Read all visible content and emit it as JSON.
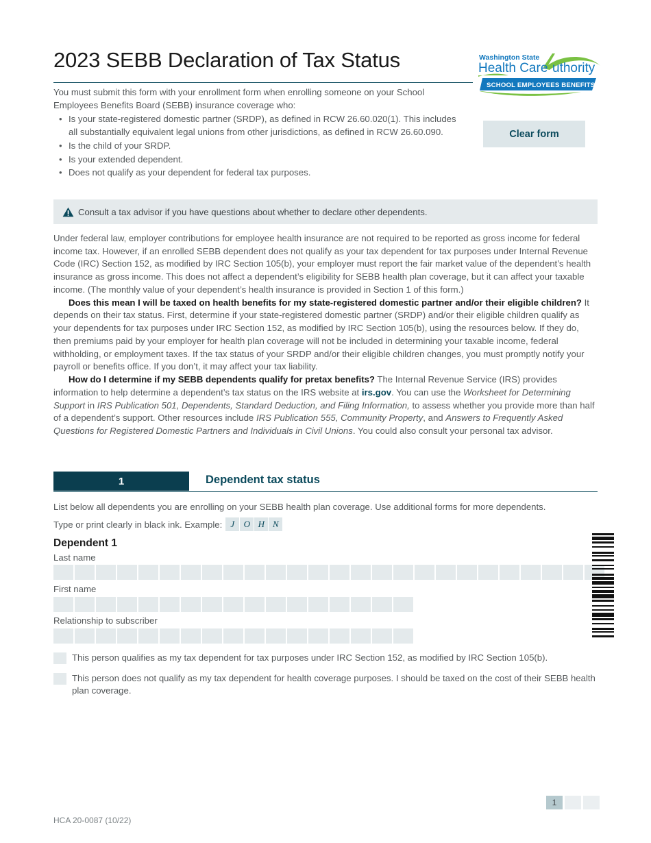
{
  "document": {
    "title": "2023 SEBB Declaration of Tax Status",
    "intro_lead": "You must submit this form with your enrollment form when enrolling someone on your School Employees Benefits Board (SEBB) insurance coverage who:",
    "intro_bullets": [
      "Is your state-registered domestic partner (SRDP), as defined in RCW 26.60.020(1). This includes all substantially equivalent legal unions from other jurisdictions, as defined in RCW 26.60.090.",
      "Is the child of your SRDP.",
      "Is your extended dependent.",
      "Does not qualify as your dependent for federal tax purposes."
    ]
  },
  "logo": {
    "line1": "Washington State",
    "line2": "Health Care Authority",
    "banner": "SCHOOL EMPLOYEES BENEFITS BOARD",
    "blue": "#1278be",
    "green": "#7ac143"
  },
  "toolbar": {
    "clear_form_label": "Clear form"
  },
  "alert": {
    "icon": "warning-triangle-icon",
    "text": "Consult a tax advisor if you have questions about whether to declare other dependents."
  },
  "body": {
    "paragraph1": "Under federal law, employer contributions for employee health insurance are not required to be reported as gross income for federal income tax. However, if an enrolled SEBB dependent does not qualify as your tax dependent for tax purposes under Internal Revenue Code (IRC) Section 152, as modified by IRC Section 105(b), your employer must report the fair market value of the dependent’s health insurance as gross income. This does not affect a dependent’s eligibility for SEBB health plan coverage, but it can affect your taxable income. (The monthly value of your dependent’s health insurance is provided in Section 1 of this form.)",
    "q1_bold": "Does this mean I will be taxed on health benefits for my state-registered domestic partner and/or their eligible children?",
    "q1_rest": " It depends on their tax status. First, determine if your state-registered domestic partner (SRDP) and/or their eligible children qualify as your dependents for tax purposes under IRC Section 152, as modified by IRC Section 105(b), using the resources below. If they do, then premiums paid by your employer for health plan coverage will not be included in determining your taxable income, federal withholding, or employment taxes. If the tax status of your SRDP and/or their eligible children changes, you must promptly notify your payroll or benefits office. If you don’t, it may affect your tax liability.",
    "q2_bold": "How do I determine if my SEBB dependents qualify for pretax benefits?",
    "q2_part1": " The Internal Revenue Service (IRS) provides information to help determine a dependent’s tax status on the IRS website at ",
    "q2_link": "irs.gov",
    "q2_part2": ". You can use the ",
    "q2_italic1": "Worksheet for Determining Support",
    "q2_part3": " in ",
    "q2_italic2": "IRS Publication 501, Dependents, Standard Deduction, and Filing Information,",
    "q2_part4": " to assess whether you provide more than half of a dependent’s support. Other resources include ",
    "q2_italic3": "IRS Publication 555, Community Property",
    "q2_part5": ", and ",
    "q2_italic4": "Answers to Frequently Asked Questions for Registered Domestic Partners and Individuals in Civil Unions",
    "q2_part6": ". You could also consult your personal tax advisor."
  },
  "section1": {
    "number": "1",
    "title": "Dependent tax status",
    "instructions": "List below all dependents you are enrolling on your SEBB health plan coverage. Use additional forms for more dependents.",
    "example_label": "Type or print clearly in black ink. Example:",
    "example_letters": [
      "J",
      "O",
      "H",
      "N"
    ],
    "dependent_heading": "Dependent 1",
    "fields": [
      {
        "label": "Last name",
        "cells": 26
      },
      {
        "label": "First name",
        "cells": 17
      },
      {
        "label": "Relationship to subscriber",
        "cells": 17
      }
    ],
    "checkboxes": [
      "This person qualifies as my tax dependent for tax purposes under IRC Section 152, as modified by IRC Section 105(b).",
      "This person does not qualify as my tax dependent for health coverage purposes. I should be taxed on the cost of their SEBB health plan coverage."
    ]
  },
  "footer": {
    "form_code": "HCA 20-0087 (10/22)",
    "page_numbers": [
      "1",
      "",
      ""
    ],
    "active_page": "1"
  },
  "colors": {
    "teal_dark": "#0b3e4f",
    "teal": "#0b4a5c",
    "field_fill": "#e4eaec",
    "banner_fill": "#e5eaec",
    "button_fill": "#dde6e9"
  }
}
